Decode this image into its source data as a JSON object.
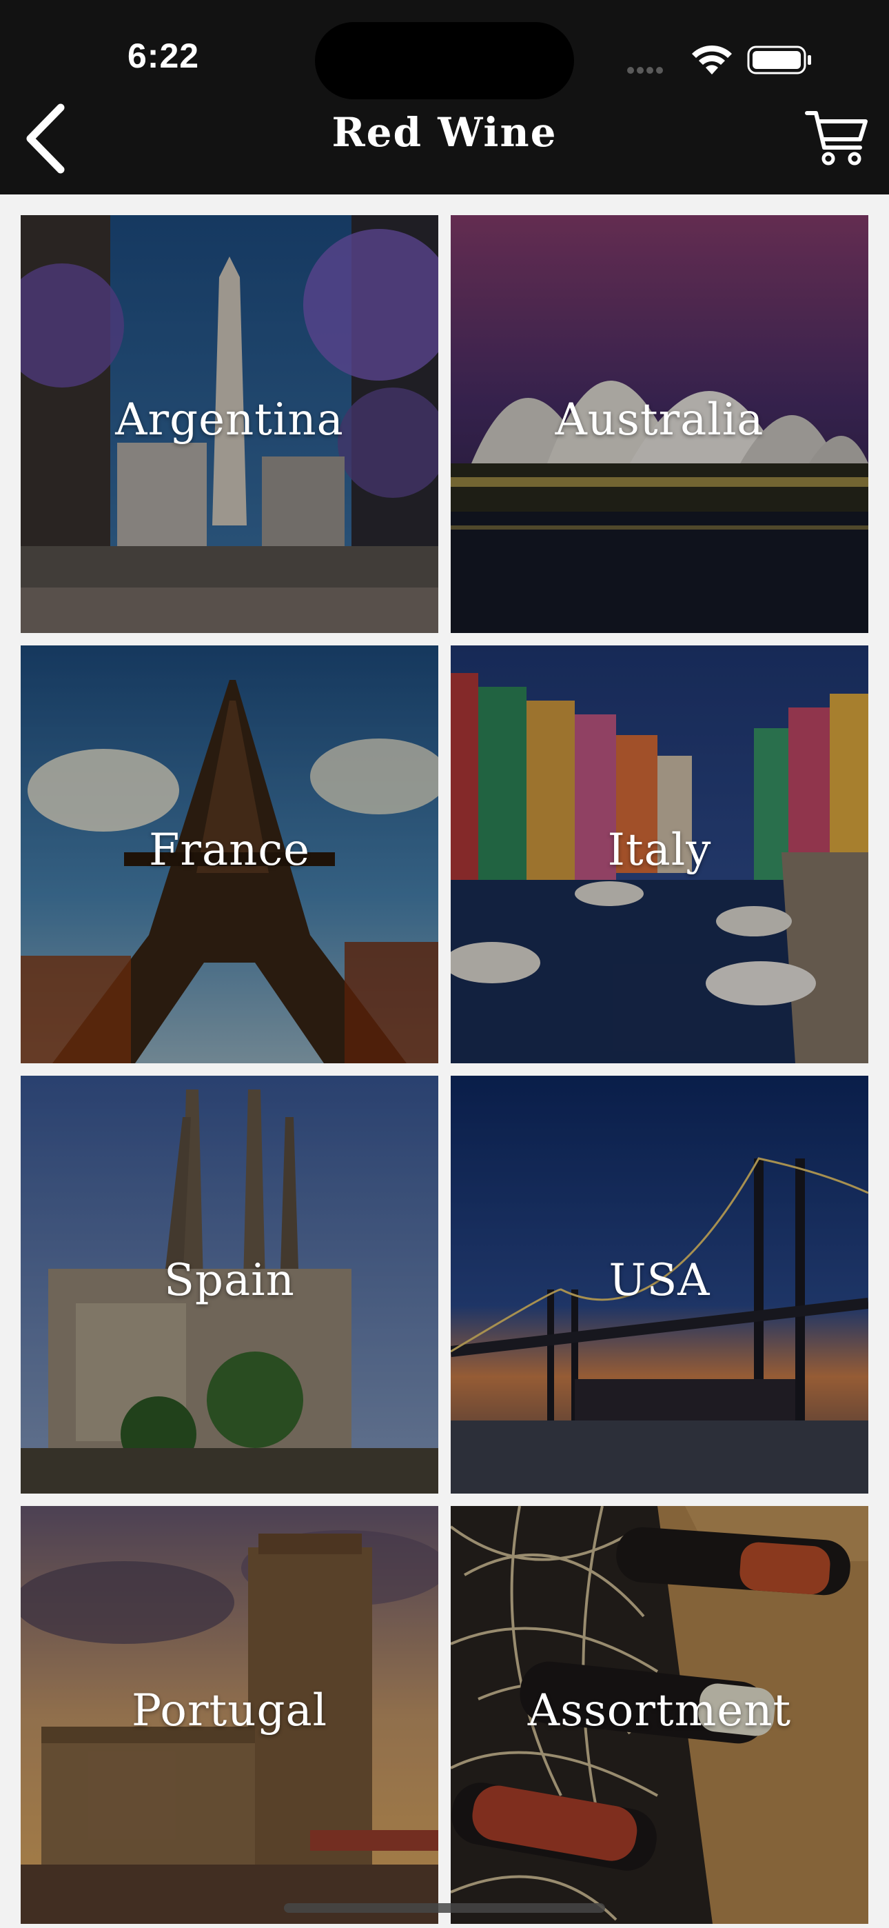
{
  "status_bar": {
    "time": "6:22"
  },
  "header": {
    "title": "Red Wine"
  },
  "icons": {
    "back": "chevron-left-icon",
    "cart": "cart-icon",
    "wifi": "wifi-icon",
    "battery": "battery-icon"
  },
  "regions": [
    {
      "label": "Argentina"
    },
    {
      "label": "Australia"
    },
    {
      "label": "France"
    },
    {
      "label": "Italy"
    },
    {
      "label": "Spain"
    },
    {
      "label": "USA"
    },
    {
      "label": "Portugal"
    },
    {
      "label": "Assortment"
    }
  ]
}
